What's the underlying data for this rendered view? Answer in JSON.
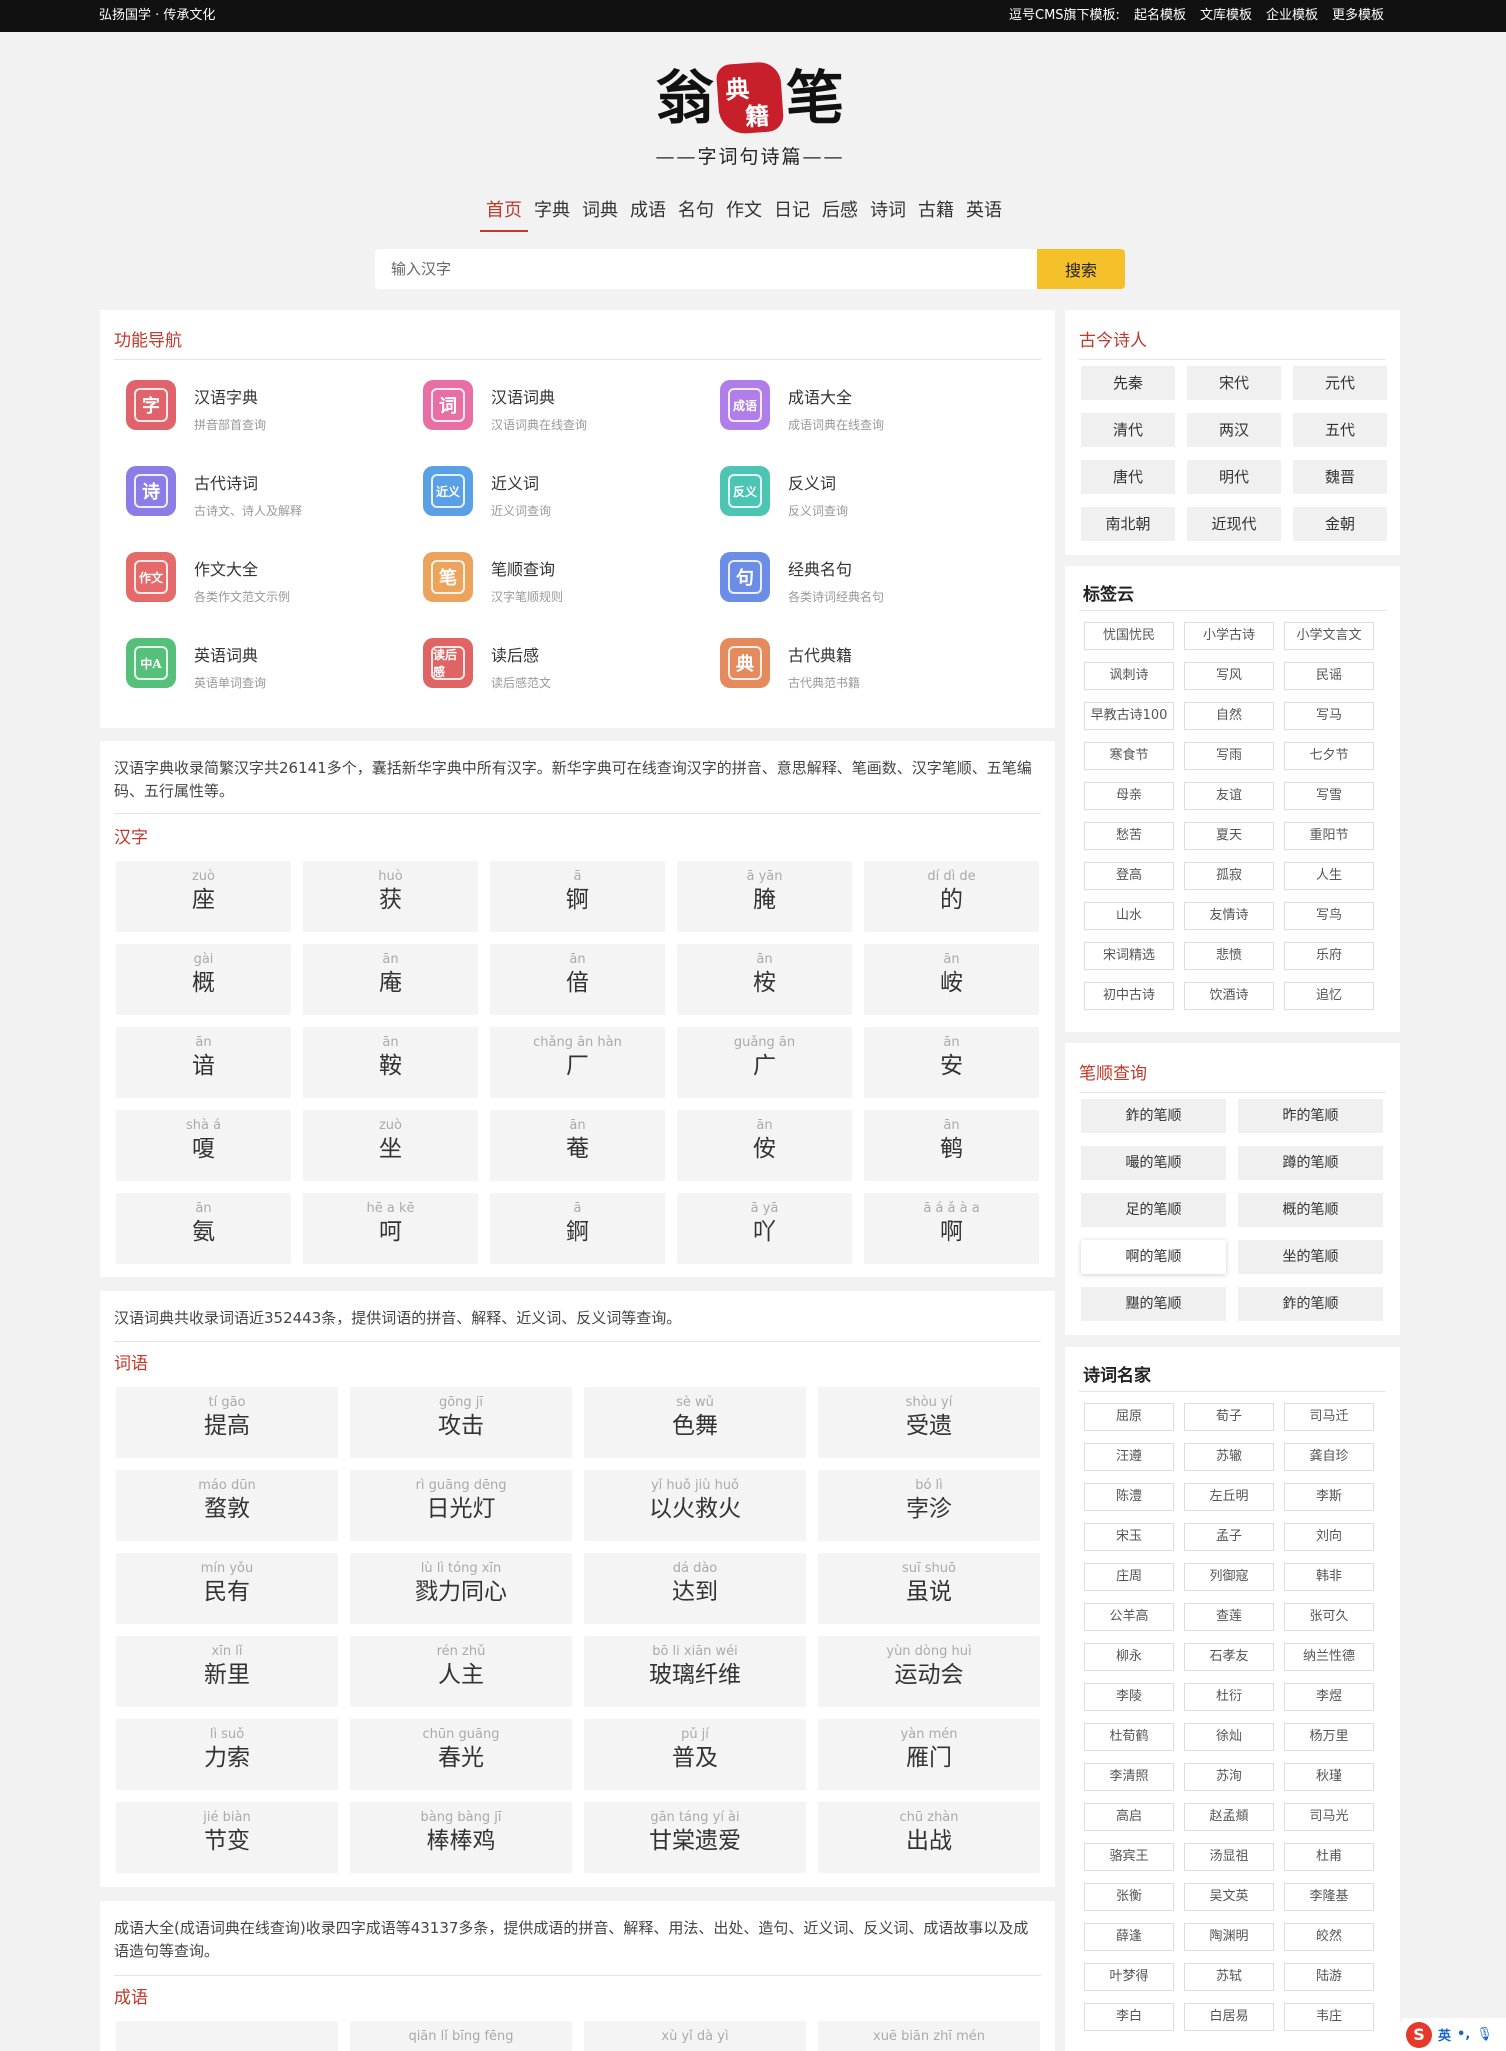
{
  "topbar": {
    "left": "弘扬国学 · 传承文化",
    "right_label": "逗号CMS旗下模板:",
    "links": [
      "起名模板",
      "文库模板",
      "企业模板",
      "更多模板"
    ]
  },
  "logo": {
    "c1": "翁",
    "seal1": "典",
    "seal2": "籍",
    "c2": "笔",
    "slogan": "——字词句诗篇——"
  },
  "nav": [
    "首页",
    "字典",
    "词典",
    "成语",
    "名句",
    "作文",
    "日记",
    "后感",
    "诗词",
    "古籍",
    "英语"
  ],
  "search": {
    "placeholder": "输入汉字",
    "button": "搜索"
  },
  "features": {
    "title": "功能导航",
    "items": [
      {
        "title": "汉语字典",
        "sub": "拼音部首查询",
        "glyph": "字",
        "color": "#e0636b",
        "icon": "dictionary-icon"
      },
      {
        "title": "汉语词典",
        "sub": "汉语词典在线查询",
        "glyph": "词",
        "color": "#e86fa4",
        "icon": "word-dictionary-icon"
      },
      {
        "title": "成语大全",
        "sub": "成语词典在线查询",
        "glyph": "成语",
        "color": "#b07ee8",
        "icon": "idiom-book-icon"
      },
      {
        "title": "古代诗词",
        "sub": "古诗文、诗人及解释",
        "glyph": "诗",
        "color": "#8a7ee6",
        "icon": "poem-icon"
      },
      {
        "title": "近义词",
        "sub": "近义词查询",
        "glyph": "近义",
        "color": "#5aa0e6",
        "icon": "synonym-icon"
      },
      {
        "title": "反义词",
        "sub": "反义词查询",
        "glyph": "反义",
        "color": "#4cc5b4",
        "icon": "antonym-icon"
      },
      {
        "title": "作文大全",
        "sub": "各类作文范文示例",
        "glyph": "作文",
        "color": "#e56a6a",
        "icon": "essay-icon"
      },
      {
        "title": "笔顺查询",
        "sub": "汉字笔顺规则",
        "glyph": "笔",
        "color": "#eca35c",
        "icon": "stroke-icon"
      },
      {
        "title": "经典名句",
        "sub": "各类诗词经典名句",
        "glyph": "句",
        "color": "#6c8de6",
        "icon": "quote-icon"
      },
      {
        "title": "英语词典",
        "sub": "英语单词查询",
        "glyph": "中A",
        "color": "#55c07a",
        "icon": "english-dictionary-icon"
      },
      {
        "title": "读后感",
        "sub": "读后感范文",
        "glyph": "读后感",
        "color": "#e06464",
        "icon": "review-icon"
      },
      {
        "title": "古代典籍",
        "sub": "古代典范书籍",
        "glyph": "典",
        "color": "#e58a5c",
        "icon": "classics-icon"
      }
    ]
  },
  "hanzi": {
    "intro": "汉语字典收录简繁汉字共26141多个，囊括新华字典中所有汉字。新华字典可在线查询汉字的拼音、意思解释、笔画数、汉字笔顺、五笔编码、五行属性等。",
    "title": "汉字",
    "items": [
      {
        "py": "zuò",
        "zh": "座"
      },
      {
        "py": "huò",
        "zh": "获"
      },
      {
        "py": "ā",
        "zh": "锕"
      },
      {
        "py": "ā yān",
        "zh": "腌"
      },
      {
        "py": "dí dì de",
        "zh": "的"
      },
      {
        "py": "gài",
        "zh": "概"
      },
      {
        "py": "ān",
        "zh": "庵"
      },
      {
        "py": "ān",
        "zh": "偣"
      },
      {
        "py": "ān",
        "zh": "桉"
      },
      {
        "py": "ān",
        "zh": "峖"
      },
      {
        "py": "ān",
        "zh": "谙"
      },
      {
        "py": "ān",
        "zh": "鞍"
      },
      {
        "py": "chǎng ān hàn",
        "zh": "厂"
      },
      {
        "py": "guǎng ān",
        "zh": "广"
      },
      {
        "py": "ān",
        "zh": "安"
      },
      {
        "py": "shà á",
        "zh": "嗄"
      },
      {
        "py": "zuò",
        "zh": "坐"
      },
      {
        "py": "ān",
        "zh": "菴"
      },
      {
        "py": "ān",
        "zh": "侒"
      },
      {
        "py": "ān",
        "zh": "鹌"
      },
      {
        "py": "ān",
        "zh": "氨"
      },
      {
        "py": "hē a kē",
        "zh": "呵"
      },
      {
        "py": "ā",
        "zh": "錒"
      },
      {
        "py": "ā yā",
        "zh": "吖"
      },
      {
        "py": "ā á ǎ à a",
        "zh": "啊"
      }
    ]
  },
  "ciyu": {
    "intro": "汉语词典共收录词语近352443条，提供词语的拼音、解释、近义词、反义词等查询。",
    "title": "词语",
    "items": [
      {
        "py": "tí gāo",
        "zh": "提高"
      },
      {
        "py": "gōng jī",
        "zh": "攻击"
      },
      {
        "py": "sè wǔ",
        "zh": "色舞"
      },
      {
        "py": "shòu yí",
        "zh": "受遗"
      },
      {
        "py": "máo dūn",
        "zh": "蝥敦"
      },
      {
        "py": "rì guāng dēng",
        "zh": "日光灯"
      },
      {
        "py": "yǐ huǒ jiù huǒ",
        "zh": "以火救火"
      },
      {
        "py": "bó lì",
        "zh": "孛沴"
      },
      {
        "py": "mín yǒu",
        "zh": "民有"
      },
      {
        "py": "lù lì tóng xīn",
        "zh": "戮力同心"
      },
      {
        "py": "dá dào",
        "zh": "达到"
      },
      {
        "py": "suī shuō",
        "zh": "虽说"
      },
      {
        "py": "xīn lǐ",
        "zh": "新里"
      },
      {
        "py": "rén zhǔ",
        "zh": "人主"
      },
      {
        "py": "bō li xiān wéi",
        "zh": "玻璃纤维"
      },
      {
        "py": "yùn dòng huì",
        "zh": "运动会"
      },
      {
        "py": "lì suǒ",
        "zh": "力索"
      },
      {
        "py": "chūn guāng",
        "zh": "春光"
      },
      {
        "py": "pǔ jí",
        "zh": "普及"
      },
      {
        "py": "yàn mén",
        "zh": "雁门"
      },
      {
        "py": "jié biàn",
        "zh": "节变"
      },
      {
        "py": "bàng bàng jī",
        "zh": "棒棒鸡"
      },
      {
        "py": "gān táng yí ài",
        "zh": "甘棠遗爱"
      },
      {
        "py": "chū zhàn",
        "zh": "出战"
      }
    ]
  },
  "chengyu": {
    "intro": "成语大全(成语词典在线查询)收录四字成语等43137多条，提供成语的拼音、解释、用法、出处、造句、近义词、反义词、成语故事以及成语造句等查询。",
    "title": "成语",
    "items": [
      {
        "py": "",
        "zh": ""
      },
      {
        "py": "qiān lǐ bīng fēng",
        "zh": ""
      },
      {
        "py": "xù yǐ dà yì",
        "zh": ""
      },
      {
        "py": "xuē biān zhī mén",
        "zh": ""
      }
    ]
  },
  "poets_era": {
    "title": "古今诗人",
    "items": [
      "先秦",
      "宋代",
      "元代",
      "清代",
      "两汉",
      "五代",
      "唐代",
      "明代",
      "魏晋",
      "南北朝",
      "近现代",
      "金朝"
    ]
  },
  "tags": {
    "title": "标签云",
    "items": [
      "忧国忧民",
      "小学古诗",
      "小学文言文",
      "讽刺诗",
      "写风",
      "民谣",
      "早教古诗100",
      "自然",
      "写马",
      "寒食节",
      "写雨",
      "七夕节",
      "母亲",
      "友谊",
      "写雪",
      "愁苦",
      "夏天",
      "重阳节",
      "登高",
      "孤寂",
      "人生",
      "山水",
      "友情诗",
      "写鸟",
      "宋词精选",
      "悲愤",
      "乐府",
      "初中古诗",
      "饮酒诗",
      "追忆"
    ]
  },
  "stroke": {
    "title": "笔顺查询",
    "items": [
      "鈼的笔顺",
      "昨的笔顺",
      "嘬的笔顺",
      "蹲的笔顺",
      "足的笔顺",
      "概的笔顺",
      "啊的笔顺",
      "坐的笔顺",
      "黮的笔顺",
      "鈼的笔顺"
    ],
    "highlight": 6
  },
  "poets": {
    "title": "诗词名家",
    "items": [
      "屈原",
      "荀子",
      "司马迁",
      "汪遵",
      "苏辙",
      "龚自珍",
      "陈澧",
      "左丘明",
      "李斯",
      "宋玉",
      "孟子",
      "刘向",
      "庄周",
      "列御寇",
      "韩非",
      "公羊高",
      "查莲",
      "张可久",
      "柳永",
      "石孝友",
      "纳兰性德",
      "李陵",
      "杜衍",
      "李煜",
      "杜荀鹤",
      "徐灿",
      "杨万里",
      "李清照",
      "苏洵",
      "秋瑾",
      "高启",
      "赵孟頫",
      "司马光",
      "骆宾王",
      "汤显祖",
      "杜甫",
      "张衡",
      "吴文英",
      "李隆基",
      "薛逢",
      "陶渊明",
      "皎然",
      "叶梦得",
      "苏轼",
      "陆游",
      "李白",
      "白居易",
      "韦庄"
    ]
  },
  "ime": {
    "logo": "S",
    "lang": "英",
    "mark": "•,"
  }
}
